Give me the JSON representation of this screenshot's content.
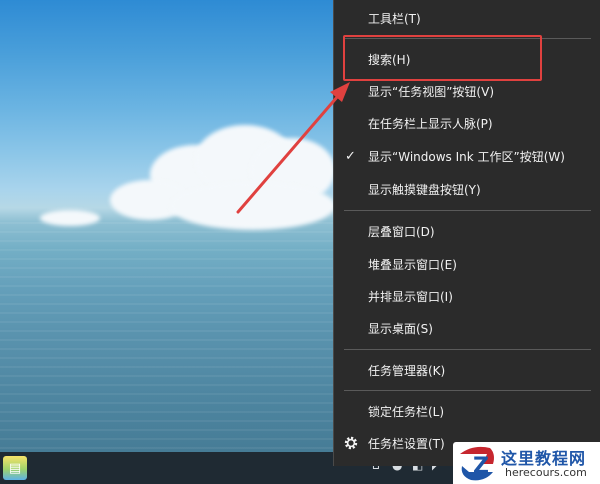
{
  "context_menu": {
    "items": [
      {
        "label": "工具栏(T)",
        "checked": false,
        "submenu": false
      },
      {
        "label": "搜索(H)",
        "checked": false,
        "submenu": false
      },
      {
        "label": "显示“任务视图”按钮(V)",
        "checked": false,
        "submenu": false
      },
      {
        "label": "在任务栏上显示人脉(P)",
        "checked": false,
        "submenu": false
      },
      {
        "label": "显示“Windows Ink 工作区”按钮(W)",
        "checked": true,
        "submenu": false
      },
      {
        "label": "显示触摸键盘按钮(Y)",
        "checked": false,
        "submenu": false
      },
      {
        "label": "层叠窗口(D)",
        "checked": false,
        "submenu": false
      },
      {
        "label": "堆叠显示窗口(E)",
        "checked": false,
        "submenu": false
      },
      {
        "label": "并排显示窗口(I)",
        "checked": false,
        "submenu": false
      },
      {
        "label": "显示桌面(S)",
        "checked": false,
        "submenu": false
      },
      {
        "label": "任务管理器(K)",
        "checked": false,
        "submenu": false
      },
      {
        "label": "锁定任务栏(L)",
        "checked": false,
        "submenu": false
      },
      {
        "label": "任务栏设置(T)",
        "checked": false,
        "icon": "gear-icon"
      }
    ],
    "check_glyph": "✓",
    "highlighted_item": "搜索(H)"
  },
  "annotation": {
    "highlight_color": "#e0413f",
    "arrow_color": "#e0413f"
  },
  "watermark": {
    "title": "这里教程网",
    "url": "herecours.com"
  },
  "taskbar": {
    "start_icon": "app-tile-icon"
  }
}
